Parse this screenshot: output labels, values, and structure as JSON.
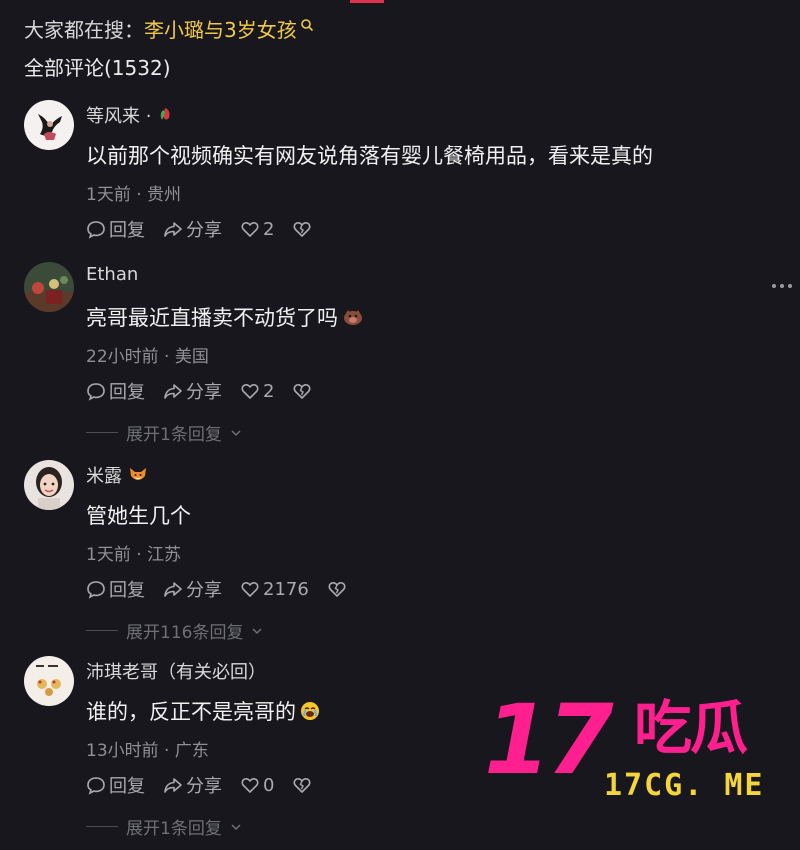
{
  "search_bar": {
    "prefix": "大家都在搜：",
    "term": "李小璐与3岁女孩"
  },
  "comments_header": {
    "label": "全部评论(1532)"
  },
  "comments": [
    {
      "username": "等风来 ·",
      "text": "以前那个视频确实有网友说角落有婴儿餐椅用品，看来是真的",
      "meta": "1天前 · 贵州",
      "reply_label": "回复",
      "share_label": "分享",
      "likes": "2",
      "expand_label": ""
    },
    {
      "username": "Ethan",
      "text": "亮哥最近直播卖不动货了吗",
      "meta": "22小时前 · 美国",
      "reply_label": "回复",
      "share_label": "分享",
      "likes": "2",
      "expand_label": "展开1条回复"
    },
    {
      "username": "米露",
      "text": "管她生几个",
      "meta": "1天前 · 江苏",
      "reply_label": "回复",
      "share_label": "分享",
      "likes": "2176",
      "expand_label": "展开116条回复"
    },
    {
      "username": "沛琪老哥（有关必回）",
      "text": "谁的，反正不是亮哥的",
      "meta": "13小时前 · 广东",
      "reply_label": "回复",
      "share_label": "分享",
      "likes": "0",
      "expand_label": "展开1条回复"
    }
  ],
  "watermark": {
    "number": "17",
    "cn": "吃瓜",
    "site": "17CG. ME"
  },
  "colors": {
    "background": "#17171d",
    "search_highlight": "#f3c94a",
    "watermark_pink": "#ff1f8e",
    "watermark_yellow": "#f4d53a"
  }
}
